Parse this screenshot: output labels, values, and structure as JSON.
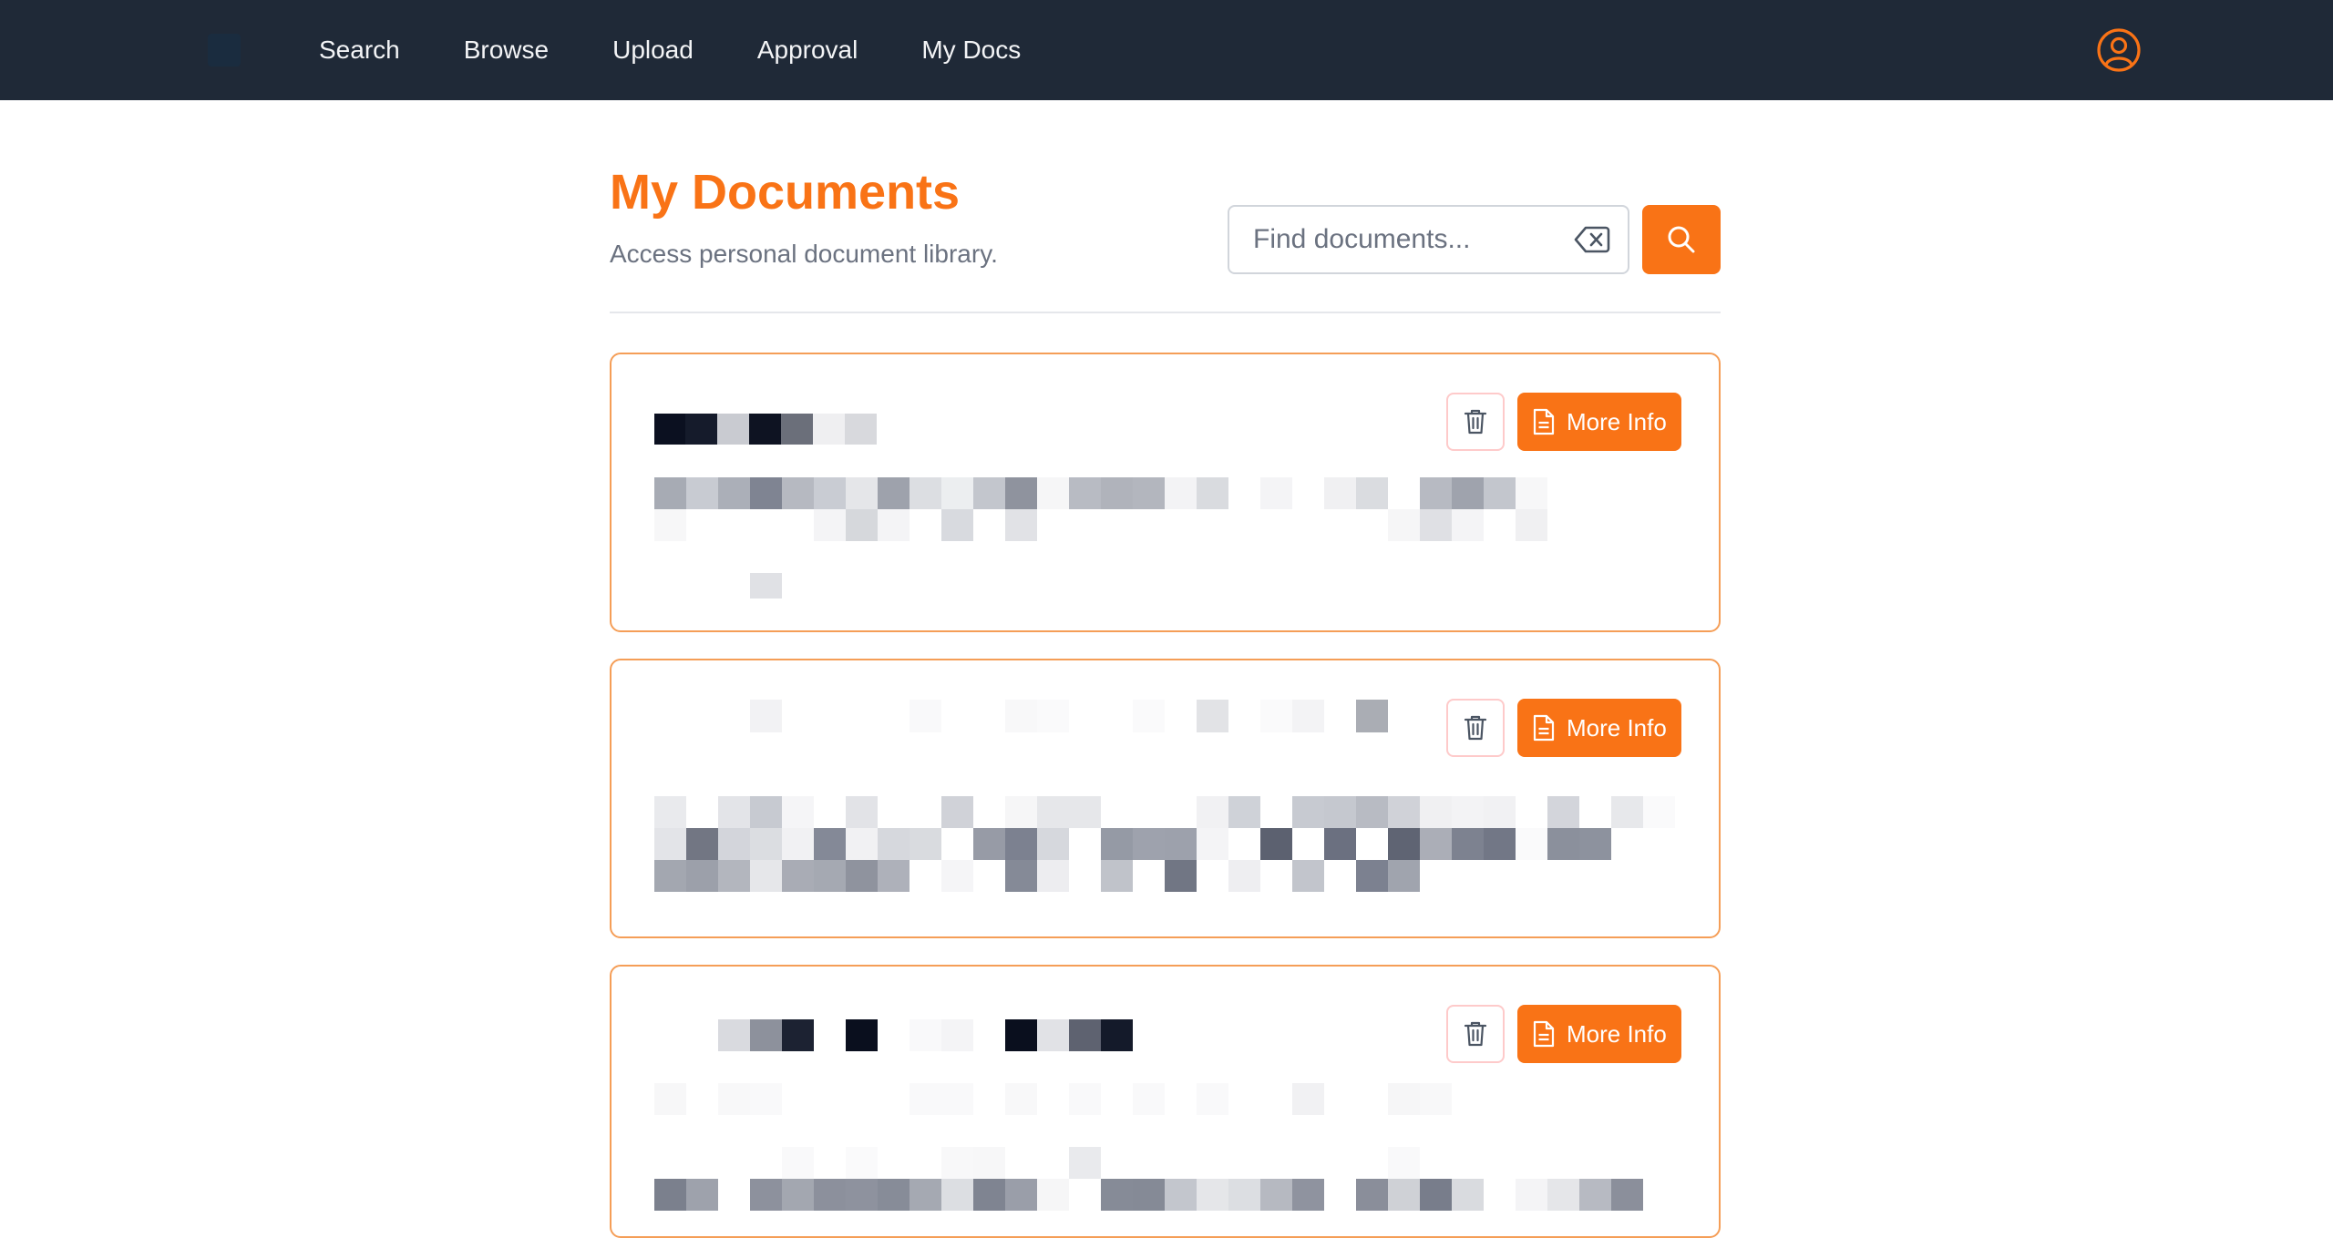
{
  "nav": {
    "items": [
      {
        "label": "Search"
      },
      {
        "label": "Browse"
      },
      {
        "label": "Upload"
      },
      {
        "label": "Approval"
      },
      {
        "label": "My Docs"
      }
    ],
    "user_icon": "user-circle-icon"
  },
  "header": {
    "title": "My Documents",
    "subtitle": "Access personal document library."
  },
  "search": {
    "placeholder": "Find documents...",
    "value": "",
    "clear_icon": "backspace-icon",
    "submit_icon": "search-icon"
  },
  "cards": [
    {
      "delete_icon": "trash-icon",
      "info_icon": "document-icon",
      "info_label": "More Info"
    },
    {
      "delete_icon": "trash-icon",
      "info_icon": "document-icon",
      "info_label": "More Info"
    },
    {
      "delete_icon": "trash-icon",
      "info_icon": "document-icon",
      "info_label": "More Info"
    }
  ],
  "colors": {
    "accent": "#f97316",
    "nav_bg": "#1f2937",
    "card_border": "#f59e57"
  }
}
